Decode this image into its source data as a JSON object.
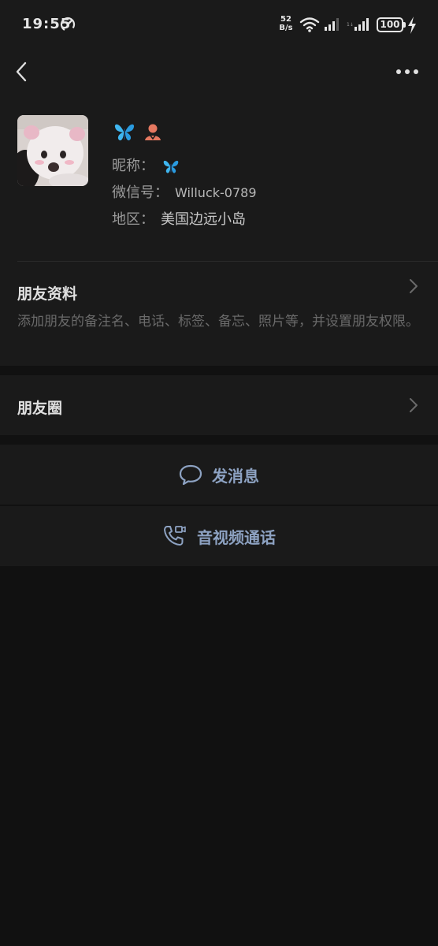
{
  "status_bar": {
    "time": "19:55",
    "net_speed_value": "52",
    "net_speed_unit": "B/s",
    "battery": "100",
    "icons": [
      "speedometer-icon",
      "wifi-icon",
      "signal-icon",
      "signal-icon",
      "battery-icon",
      "charging-icon"
    ]
  },
  "nav": {
    "back_icon": "chevron-left-icon",
    "more_icon": "more-dots-icon"
  },
  "profile": {
    "display_name_emoji": "butterfly",
    "gender_icon": "female-person-icon",
    "nickname_label": "昵称：",
    "nickname_emoji": "butterfly",
    "wechat_id_label": "微信号：",
    "wechat_id": "Willuck-0789",
    "region_label": "地区：",
    "region": "美国边远小岛"
  },
  "friend_info": {
    "title": "朋友资料",
    "description": "添加朋友的备注名、电话、标签、备忘、照片等，并设置朋友权限。"
  },
  "moments": {
    "title": "朋友圈"
  },
  "actions": {
    "message": "发消息",
    "call": "音视频通话"
  },
  "colors": {
    "background": "#111111",
    "card": "#1a1a1a",
    "accent": "#8da2c2",
    "butterfly": "#3fb6f0",
    "gender": "#e57860"
  }
}
